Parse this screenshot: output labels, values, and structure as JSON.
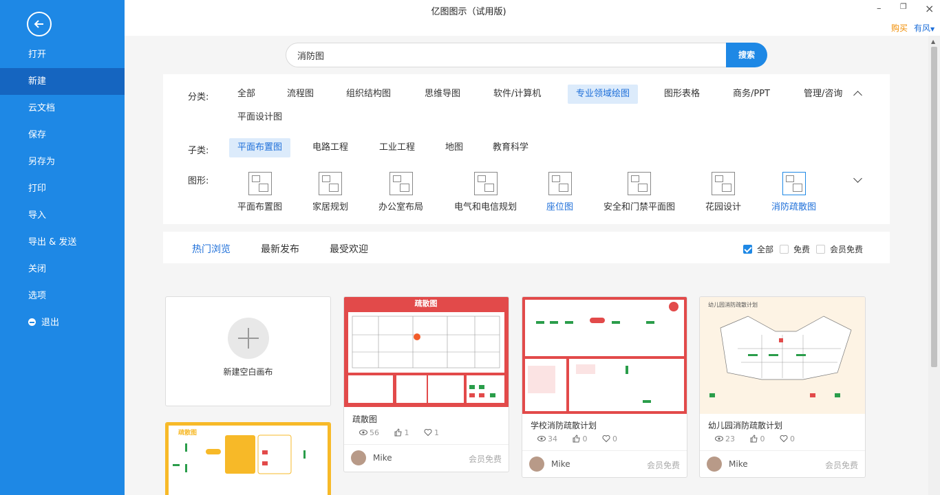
{
  "app": {
    "title": "亿图图示（试用版)",
    "buy": "购买",
    "user": "有风"
  },
  "sidebar": {
    "items": [
      {
        "label": "打开"
      },
      {
        "label": "新建"
      },
      {
        "label": "云文档"
      },
      {
        "label": "保存"
      },
      {
        "label": "另存为"
      },
      {
        "label": "打印"
      },
      {
        "label": "导入"
      },
      {
        "label": "导出 & 发送"
      },
      {
        "label": "关闭"
      },
      {
        "label": "选项"
      },
      {
        "label": "退出"
      }
    ],
    "active": "新建"
  },
  "search": {
    "value": "消防图",
    "button": "搜索"
  },
  "filters": {
    "category_label": "分类:",
    "categories": [
      "全部",
      "流程图",
      "组织结构图",
      "思维导图",
      "软件/计算机",
      "专业领域绘图",
      "图形表格",
      "商务/PPT",
      "管理/咨询",
      "平面设计图"
    ],
    "category_selected": "专业领域绘图",
    "sub_label": "子类:",
    "subs": [
      "平面布置图",
      "电路工程",
      "工业工程",
      "地图",
      "教育科学"
    ],
    "sub_selected": "平面布置图",
    "shape_label": "图形:",
    "shapes": [
      "平面布置图",
      "家居规划",
      "办公室布局",
      "电气和电信规划",
      "座位图",
      "安全和门禁平面图",
      "花园设计",
      "消防疏散图"
    ],
    "shape_selected": "消防疏散图"
  },
  "tabs": {
    "items": [
      "热门浏览",
      "最新发布",
      "最受欢迎"
    ],
    "active": "热门浏览",
    "checks": [
      {
        "label": "全部",
        "checked": true
      },
      {
        "label": "免费",
        "checked": false
      },
      {
        "label": "会员免费",
        "checked": false
      }
    ]
  },
  "new_canvas": {
    "label": "新建空白画布"
  },
  "templates": [
    {
      "title": "疏散图",
      "views": "56",
      "likes": "1",
      "favs": "1",
      "author": "Mike",
      "price": "会员免费"
    },
    {
      "title": "学校消防疏散计划",
      "views": "34",
      "likes": "0",
      "favs": "0",
      "author": "Mike",
      "price": "会员免费"
    },
    {
      "title": "幼儿园消防疏散计划",
      "views": "23",
      "likes": "0",
      "favs": "0",
      "author": "Mike",
      "price": "会员免费"
    }
  ],
  "template_image_text": {
    "t1_header": "疏散图",
    "t3_header": "幼儿园消防疏散计划",
    "t4_header": "疏散图"
  },
  "colors": {
    "accent": "#1e88e5",
    "sidebar": "#1e88e5",
    "sidebar_active": "#1565c0",
    "fire_red": "#e05050",
    "fire_yellow": "#f7b928"
  }
}
